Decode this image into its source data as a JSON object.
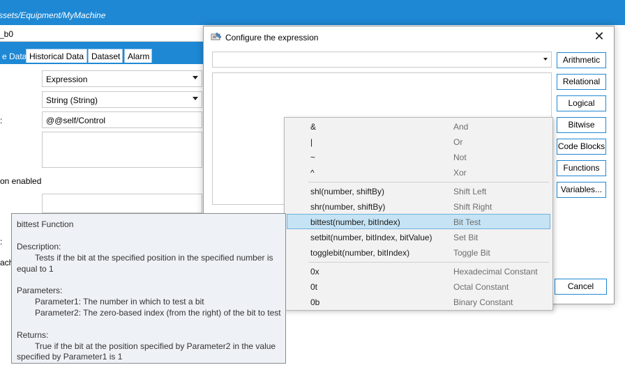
{
  "background": {
    "path": "ssets/Equipment/MyMachine",
    "name": "_b0",
    "tabs": [
      "e Data",
      "Historical Data",
      "Dataset",
      "Alarm"
    ],
    "type_combo": "Expression",
    "datatype_combo": "String (String)",
    "control_field": "@@self/Control",
    "label_option": "on enabled",
    "label_colon1": ":",
    "label_colon2": ":",
    "label_each": "ach"
  },
  "dialog": {
    "title": "Configure the expression",
    "close_glyph": "✕",
    "expression_combo_value": "",
    "buttons": [
      "Arithmetic",
      "Relational",
      "Logical",
      "Bitwise",
      "Code Blocks",
      "Functions",
      "Variables..."
    ],
    "cancel_label": "Cancel"
  },
  "menu": {
    "groups": [
      [
        {
          "code": "&",
          "desc": "And"
        },
        {
          "code": "|",
          "desc": "Or"
        },
        {
          "code": "~",
          "desc": "Not"
        },
        {
          "code": "^",
          "desc": "Xor"
        }
      ],
      [
        {
          "code": "shl(number, shiftBy)",
          "desc": "Shift Left"
        },
        {
          "code": "shr(number, shiftBy)",
          "desc": "Shift Right"
        },
        {
          "code": "bittest(number, bitIndex)",
          "desc": "Bit Test",
          "selected": true
        },
        {
          "code": "setbit(number, bitIndex, bitValue)",
          "desc": "Set Bit"
        },
        {
          "code": "togglebit(number, bitIndex)",
          "desc": "Toggle Bit"
        }
      ],
      [
        {
          "code": "0x",
          "desc": "Hexadecimal Constant"
        },
        {
          "code": "0t",
          "desc": "Octal Constant"
        },
        {
          "code": "0b",
          "desc": "Binary Constant"
        }
      ]
    ]
  },
  "tooltip": {
    "title": "bittest Function",
    "description_label": "Description:",
    "description_1": "Tests if the bit at the specified position in the specified number is",
    "description_2": "equal to 1",
    "parameters_label": "Parameters:",
    "parameter_1": "Parameter1: The number in which to test a bit",
    "parameter_2": "Parameter2: The zero-based index (from the right) of the bit to test",
    "returns_label": "Returns:",
    "returns_1": "True if the bit at the position specified by Parameter2 in the value",
    "returns_2": "specified by Parameter1 is 1"
  },
  "colors": {
    "accent": "#1e88d4",
    "selection": "#c5e3f4",
    "tooltip_bg": "#eef1f6"
  }
}
